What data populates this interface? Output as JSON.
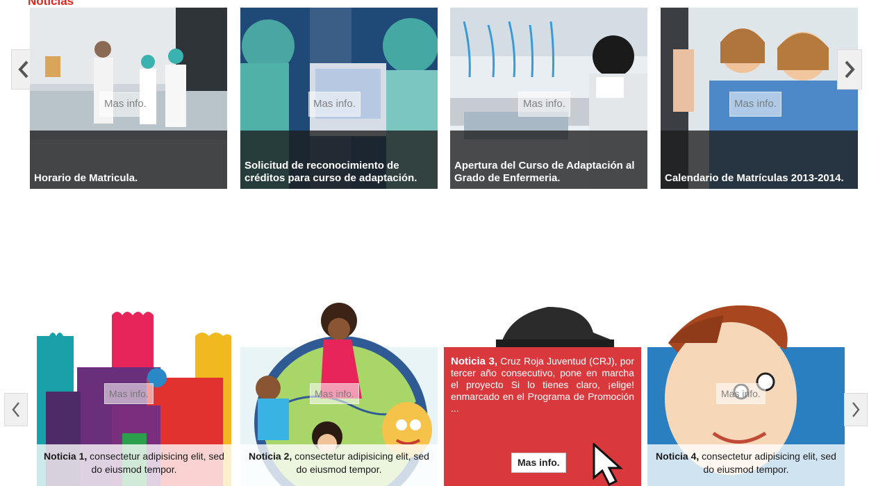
{
  "section_title": "Noticias",
  "carousel1": {
    "prev_label": "<",
    "next_label": ">",
    "more_label": "Mas info.",
    "cards": [
      {
        "caption": "Horario de Matricula."
      },
      {
        "caption": "Solicitud de reconocimiento de créditos para curso de adaptación."
      },
      {
        "caption": "Apertura del Curso de Adaptación al Grado de Enfermeria."
      },
      {
        "caption": "Calendario de Matrículas 2013-2014."
      }
    ]
  },
  "carousel2": {
    "prev_label": "<",
    "next_label": ">",
    "more_label": "Mas info.",
    "cards": [
      {
        "title": "Noticia 1,",
        "text": "consectetur adipisicing elit, sed do eiusmod tempor."
      },
      {
        "title": "Noticia 2,",
        "text": "consectetur adipisicing elit, sed do eiusmod tempor."
      },
      {
        "title": "Noticia 3,",
        "text": "Cruz Roja Juventud (CRJ), por tercer año consecutivo, pone en marcha el proyecto Si lo tienes claro, ¡elige! enmarcado en el Programa de Promoción ..."
      },
      {
        "title": "Noticia 4,",
        "text": "consectetur adipisicing elit, sed do eiusmod tempor."
      }
    ],
    "hover_button": "Mas info."
  },
  "colors": {
    "accent": "#e0231b",
    "highlight_card": "#d9393d"
  }
}
